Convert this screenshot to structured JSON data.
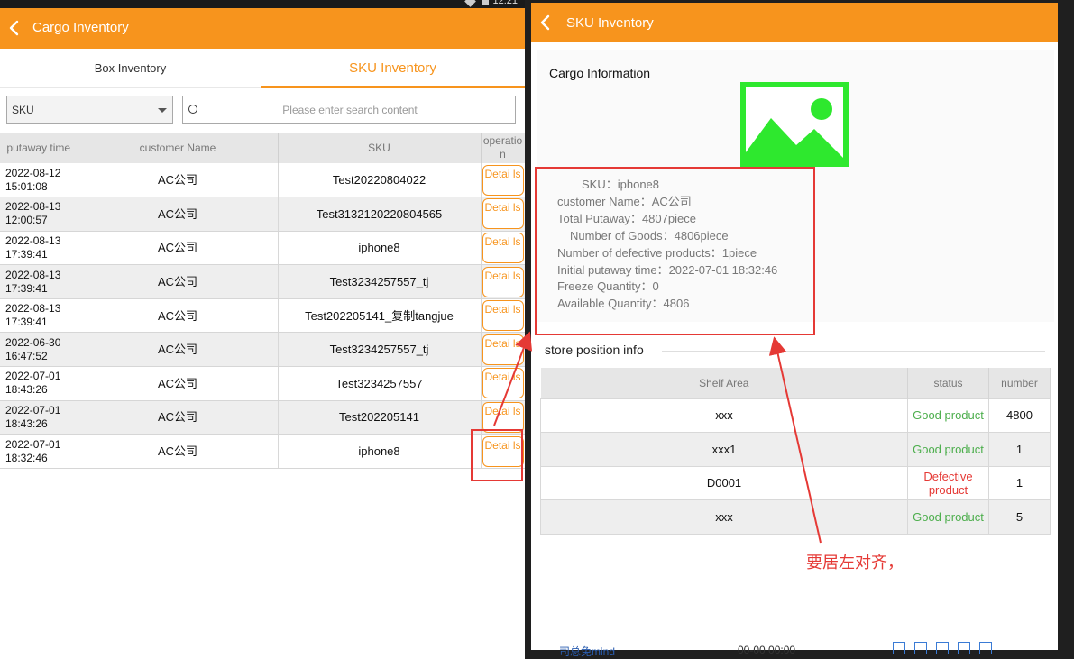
{
  "left": {
    "title": "Cargo Inventory",
    "tabs": [
      {
        "label": "Box Inventory",
        "active": false
      },
      {
        "label": "SKU Inventory",
        "active": true
      }
    ],
    "filter": {
      "field": "SKU",
      "search_placeholder": "Please enter search content"
    },
    "columns": [
      "putaway time",
      "customer Name",
      "SKU",
      "operatio n"
    ],
    "rows": [
      {
        "time": "2022-08-12 15:01:08",
        "customer": "AC公司",
        "sku": "Test20220804022",
        "op": "Detai ls"
      },
      {
        "time": "2022-08-13 12:00:57",
        "customer": "AC公司",
        "sku": "Test3132120220804565",
        "op": "Detai ls"
      },
      {
        "time": "2022-08-13 17:39:41",
        "customer": "AC公司",
        "sku": "iphone8",
        "op": "Detai ls"
      },
      {
        "time": "2022-08-13 17:39:41",
        "customer": "AC公司",
        "sku": "Test3234257557_tj",
        "op": "Detai ls"
      },
      {
        "time": "2022-08-13 17:39:41",
        "customer": "AC公司",
        "sku": "Test202205141_复制tangjue",
        "op": "Detai ls"
      },
      {
        "time": "2022-06-30 16:47:52",
        "customer": "AC公司",
        "sku": "Test3234257557_tj",
        "op": "Detai ls"
      },
      {
        "time": "2022-07-01 18:43:26",
        "customer": "AC公司",
        "sku": "Test3234257557",
        "op": "Detai ls"
      },
      {
        "time": "2022-07-01 18:43:26",
        "customer": "AC公司",
        "sku": "Test202205141",
        "op": "Detai ls"
      },
      {
        "time": "2022-07-01 18:32:46",
        "customer": "AC公司",
        "sku": "iphone8",
        "op": "Detai ls"
      }
    ]
  },
  "right": {
    "title": "SKU Inventory",
    "cargo_heading": "Cargo Information",
    "info": [
      {
        "label": "SKU：",
        "value": "iphone8"
      },
      {
        "label": "customer Name：",
        "value": "AC公司"
      },
      {
        "label": "Total Putaway：",
        "value": "4807piece"
      },
      {
        "label": "Number of Goods：",
        "value": "4806piece"
      },
      {
        "label": "Number of defective products：",
        "value": "1piece"
      },
      {
        "label": "Initial putaway time：",
        "value": "2022-07-01 18:32:46"
      },
      {
        "label": "Freeze Quantity：",
        "value": "0"
      },
      {
        "label": "Available Quantity：",
        "value": "4806"
      }
    ],
    "store_heading": "store position info",
    "store_columns": [
      "Shelf Area",
      "status",
      "number"
    ],
    "store_rows": [
      {
        "shelf": "xxx",
        "status": "Good product",
        "kind": "good",
        "number": "4800"
      },
      {
        "shelf": "xxx1",
        "status": "Good product",
        "kind": "good",
        "number": "1"
      },
      {
        "shelf": "D0001",
        "status": "Defective product",
        "kind": "bad",
        "number": "1"
      },
      {
        "shelf": "xxx",
        "status": "Good product",
        "kind": "good",
        "number": "5"
      }
    ]
  },
  "background_peek": {
    "left_text": "司总免mind",
    "right_text": "00-00 00:00"
  },
  "annotation": {
    "note": "要居左对齐，",
    "color": "#e53935"
  },
  "colors": {
    "accent": "#f7941d",
    "good": "#4cae4c",
    "defective": "#e53935",
    "image_icon": "#2ee82e"
  }
}
